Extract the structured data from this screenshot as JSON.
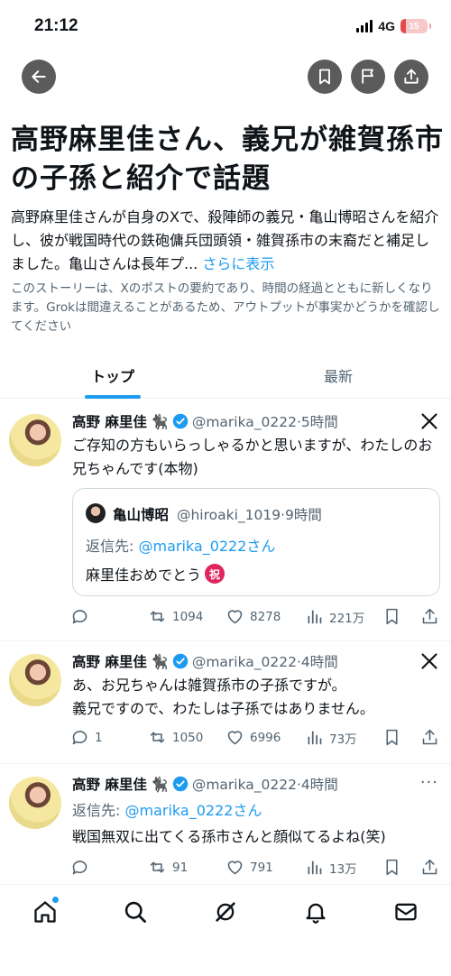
{
  "status_bar": {
    "time": "21:12",
    "network": "4G",
    "battery": "15",
    "battery_level": 0.15
  },
  "colors": {
    "accent": "#1d9bf0",
    "text": "#0f1419",
    "muted": "#536471",
    "verified": "#1d9bf0",
    "battery_low": "#e54b4b"
  },
  "header_buttons": [
    "back-arrow-icon",
    "bookmark-icon",
    "flag-icon",
    "share-icon"
  ],
  "story": {
    "title": "高野麻里佳さん、義兄が雑賀孫市の子孫と紹介で話題",
    "summary": "高野麻里佳さんが自身のXで、殺陣師の義兄・亀山博昭さんを紹介し、彼が戦国時代の鉄砲傭兵団頭領・雑賀孫市の末裔だと補足しました。亀山さんは長年プ...",
    "more_label": "さらに表示",
    "disclaimer": "このストーリーは、Xのポストの要約であり、時間の経過とともに新しくなります。Grokは間違えることがあるため、アウトプットが事実かどうかを確認してください"
  },
  "tabs": [
    {
      "label": "トップ",
      "active": true
    },
    {
      "label": "最新",
      "active": false
    }
  ],
  "posts": [
    {
      "author": "高野 麻里佳",
      "cat": "🐈‍⬛",
      "handle_time": "@marika_0222·5時間",
      "text": "ご存知の方もいらっしゃるかと思いますが、わたしのお兄ちゃんです(本物)",
      "quote": {
        "author": "亀山博昭",
        "handle_time": "@hiroaki_1019·9時間",
        "reply_prefix": "返信先: ",
        "reply_mention": "@marika_0222さん",
        "text": "麻里佳おめでとう",
        "emoji": "祝"
      },
      "replies": "",
      "reposts": "1094",
      "likes": "8278",
      "views": "221万"
    },
    {
      "author": "高野 麻里佳",
      "cat": "🐈‍⬛",
      "handle_time": "@marika_0222·4時間",
      "text": "あ、お兄ちゃんは雑賀孫市の子孫ですが。\n義兄ですので、わたしは子孫ではありません。",
      "replies": "1",
      "reposts": "1050",
      "likes": "6996",
      "views": "73万"
    },
    {
      "author": "高野 麻里佳",
      "cat": "🐈‍⬛",
      "handle_time": "@marika_0222·4時間",
      "reply_prefix": "返信先: ",
      "reply_mention": "@marika_0222さん",
      "text": "戦国無双に出てくる孫市さんと顔似てるよね(笑)",
      "replies": "",
      "reposts": "91",
      "likes": "791",
      "views": "13万"
    }
  ],
  "bottom_nav": [
    "home-icon",
    "search-icon",
    "grok-icon",
    "notifications-icon",
    "messages-icon"
  ]
}
